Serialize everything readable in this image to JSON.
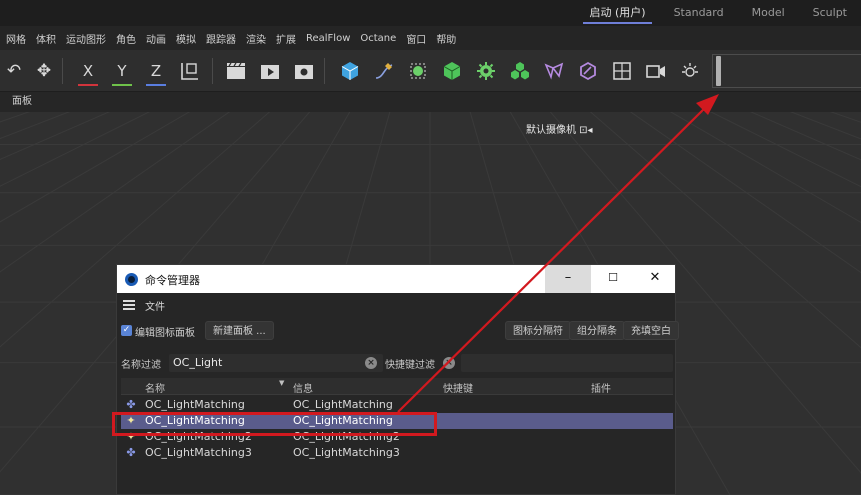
{
  "layout_tabs": {
    "items": [
      {
        "label": "启动 (用户)",
        "active": true
      },
      {
        "label": "Standard",
        "active": false
      },
      {
        "label": "Model",
        "active": false
      },
      {
        "label": "Sculpt",
        "active": false
      }
    ]
  },
  "menubar": {
    "items": [
      "网格",
      "体积",
      "运动图形",
      "角色",
      "动画",
      "模拟",
      "跟踪器",
      "渲染",
      "扩展",
      "RealFlow",
      "Octane",
      "窗口",
      "帮助"
    ]
  },
  "toolbar": {
    "undo": "↶",
    "move": "✥",
    "x": "X",
    "y": "Y",
    "z": "Z",
    "coord": "⟟",
    "light_icon": "light-bulb-icon"
  },
  "panelbar": {
    "label": "面板"
  },
  "viewport": {
    "camera_label": "默认摄像机 ⊡◂"
  },
  "command_manager": {
    "title": "命令管理器",
    "min": "–",
    "max": "☐",
    "close": "✕",
    "menu_file": "文件",
    "edit_icon_panel": "编辑图标面板",
    "edit_icon_panel_checked": true,
    "new_panel": "新建面板 ...",
    "icon_separator": "图标分隔符",
    "group_separator": "组分隔条",
    "fill_space": "充填空白",
    "name_filter_label": "名称过滤",
    "name_filter_value": "OC_Light",
    "hotkey_filter_label": "快捷键过滤",
    "hotkey_filter_value": "",
    "columns": [
      "名称",
      "信息",
      "快捷键",
      "插件"
    ],
    "rows": [
      {
        "name": "OC_LightMatching",
        "info": "OC_LightMatching",
        "selected": false
      },
      {
        "name": "OC_LightMatching",
        "info": "OC_LightMatching",
        "selected": true
      },
      {
        "name": "OC_LightMatching2",
        "info": "OC_LightMatching2",
        "selected": false
      },
      {
        "name": "OC_LightMatching3",
        "info": "OC_LightMatching3",
        "selected": false
      }
    ]
  },
  "colors": {
    "annotation_red": "#d2191f",
    "selection": "#5a5c8c",
    "accent": "#6f7fd8"
  }
}
